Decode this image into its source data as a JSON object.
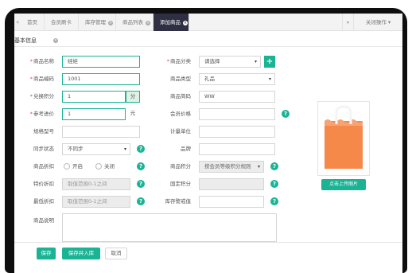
{
  "tabs": [
    {
      "label": "首页"
    },
    {
      "label": "会员刷卡"
    },
    {
      "label": "库存管理"
    },
    {
      "label": "商品列表"
    },
    {
      "label": "添加商品",
      "active": true
    }
  ],
  "topbar": {
    "forward_icon": "double-chevron-right-icon",
    "power_icon": "power-icon",
    "close_ops_label": "关闭操作"
  },
  "section_title": "基本信息",
  "form": {
    "name": {
      "label": "商品名称",
      "value": "娃娃"
    },
    "category": {
      "label": "商品分类",
      "value": "请选择"
    },
    "code": {
      "label": "商品编码",
      "value": "1001"
    },
    "type": {
      "label": "商品类型",
      "value": "礼品"
    },
    "points": {
      "label": "兑换积分",
      "value": "1",
      "unit": "分"
    },
    "brief_code": {
      "label": "商品简码",
      "value": "WW"
    },
    "ref_price": {
      "label": "参考进价",
      "value": "1",
      "unit": "元"
    },
    "member_price": {
      "label": "会员价格",
      "value": ""
    },
    "spec": {
      "label": "规格型号",
      "value": ""
    },
    "unit": {
      "label": "计量单位",
      "value": ""
    },
    "sync_status": {
      "label": "同步状态",
      "value": "不同步"
    },
    "brand": {
      "label": "品牌",
      "value": ""
    },
    "discount": {
      "label": "商品折扣",
      "option_on": "开启",
      "option_off": "关闭"
    },
    "points_rule": {
      "label": "商品积分",
      "value": "按会员等级积分规则"
    },
    "special_discount": {
      "label": "特价折扣",
      "placeholder": "取值范围0-1之间"
    },
    "fixed_points": {
      "label": "固定积分",
      "value": ""
    },
    "min_discount": {
      "label": "最低折扣",
      "placeholder": "取值范围0-1之间"
    },
    "stock_alert": {
      "label": "库存警戒值",
      "value": ""
    },
    "description": {
      "label": "商品说明",
      "value": ""
    }
  },
  "upload_button": "点击上传图片",
  "buttons": {
    "save": "保存",
    "save_and_add": "保存并入库",
    "cancel": "取消"
  },
  "colors": {
    "accent": "#1ab394",
    "active_tab": "#2f2f44",
    "required": "#e04545",
    "bag_orange": "#f5894a"
  }
}
